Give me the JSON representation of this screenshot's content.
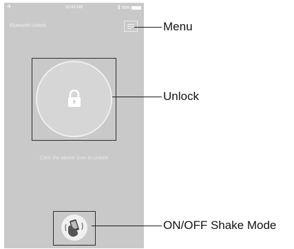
{
  "status_bar": {
    "airplane_icon": "airplane-icon",
    "time": "10:42 AM",
    "bluetooth_icon": "bluetooth-icon",
    "battery_percent": "99%",
    "battery_level": 0.99
  },
  "app": {
    "title": "Bluetooth Unlock",
    "menu_icon": "hamburger-menu-icon",
    "lock_icon": "padlock-icon",
    "hint": "Click the above Icon to unlock",
    "shake_icon": "hand-shaking-phone-icon"
  },
  "callouts": {
    "menu": "Menu",
    "unlock": "Unlock",
    "shake": "ON/OFF Shake Mode"
  },
  "colors": {
    "screen_background": "#c9c9c9",
    "circle_fill": "#d6d6d6",
    "text_light": "#ededed",
    "callout_text": "#111111"
  }
}
